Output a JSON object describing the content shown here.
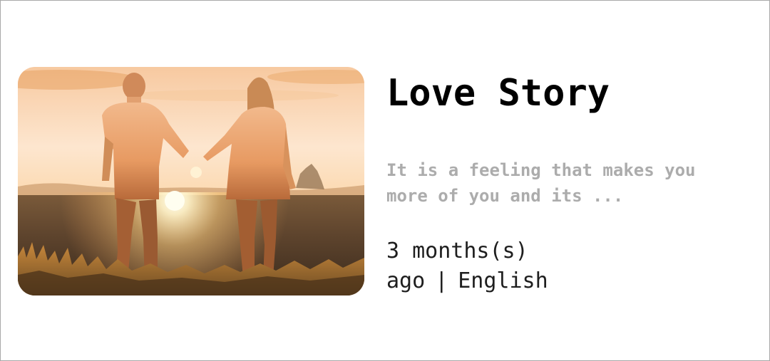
{
  "post": {
    "title": "Love Story",
    "excerpt": "It is a feeling that makes you more of you and its ...",
    "age": "3 months(s) ago",
    "separator": "|",
    "language": "English"
  },
  "image": {
    "alt": "Silhouette of a couple holding hands walking into a sunset over a grassy field",
    "icon": "sunset-photo"
  },
  "colors": {
    "title": "#000000",
    "excerpt": "#acacac",
    "meta": "#1e1e1e",
    "border": "#a9a9a9"
  }
}
